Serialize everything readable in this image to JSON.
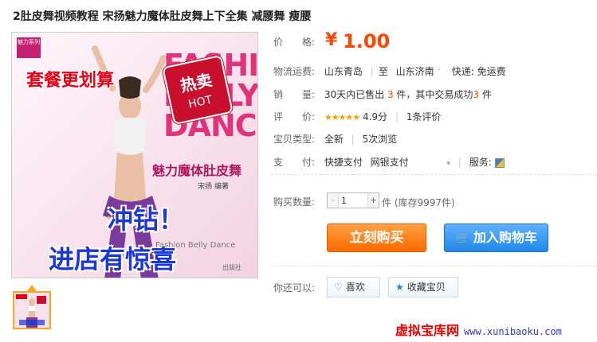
{
  "product": {
    "title": "2肚皮舞视频教程 宋扬魅力魔体肚皮舞上下全集 减腰舞 瘦腰"
  },
  "image": {
    "logo_text": "魅力系列",
    "promo_text": "套餐更划算",
    "hot_cn": "热卖",
    "hot_en": "HOT",
    "dance_text": "FASHION BELLY DANCE",
    "book_title": "魅力魔体肚皮舞",
    "author": "宋扬 编著",
    "overlay_line1": "冲钻！",
    "overlay_line2": "进店有惊喜",
    "subtitle_en": "Fashion Belly Dance",
    "publisher": "出版社"
  },
  "info": {
    "price_label": "价　　格:",
    "price_currency": "¥",
    "price_value": "1.00",
    "shipping_label": "物流运费:",
    "ship_from": "山东青岛",
    "ship_to_sep": "至",
    "ship_to": "山东济南",
    "ship_fee": "快递: 免运费",
    "sales_label": "销　　量:",
    "sales_prefix": "30天内已售出",
    "sales_count": "3",
    "sales_mid": "件，其中交易成功",
    "sales_success": "3",
    "sales_suffix": "件",
    "rating_label": "评　　价:",
    "rating_stars": "★★★★★",
    "rating_score": "4.9分",
    "rating_count": "1条评价",
    "type_label": "宝贝类型:",
    "type_value": "全新",
    "views": "5次浏览",
    "payment_label": "支　　付:",
    "payment_1": "快捷支付",
    "payment_2": "网银支付",
    "service_label": "服务:"
  },
  "purchase": {
    "qty_label": "购买数量:",
    "qty_minus": "-",
    "qty_value": "1",
    "qty_plus": "+",
    "qty_unit": "件 (库存9997件)",
    "buy_now": "立刻购买",
    "add_cart": "加入购物车",
    "also_label": "你还可以:",
    "like": "喜欢",
    "favorite": "收藏宝贝"
  },
  "watermark": {
    "cn": "虚拟宝库网",
    "url": "www.xunibaoku.com"
  },
  "colors": {
    "price": "#ff4400",
    "buy_button": "#ff6a00",
    "cart_button": "#1f88e8",
    "watermark_red": "#ee0000"
  }
}
